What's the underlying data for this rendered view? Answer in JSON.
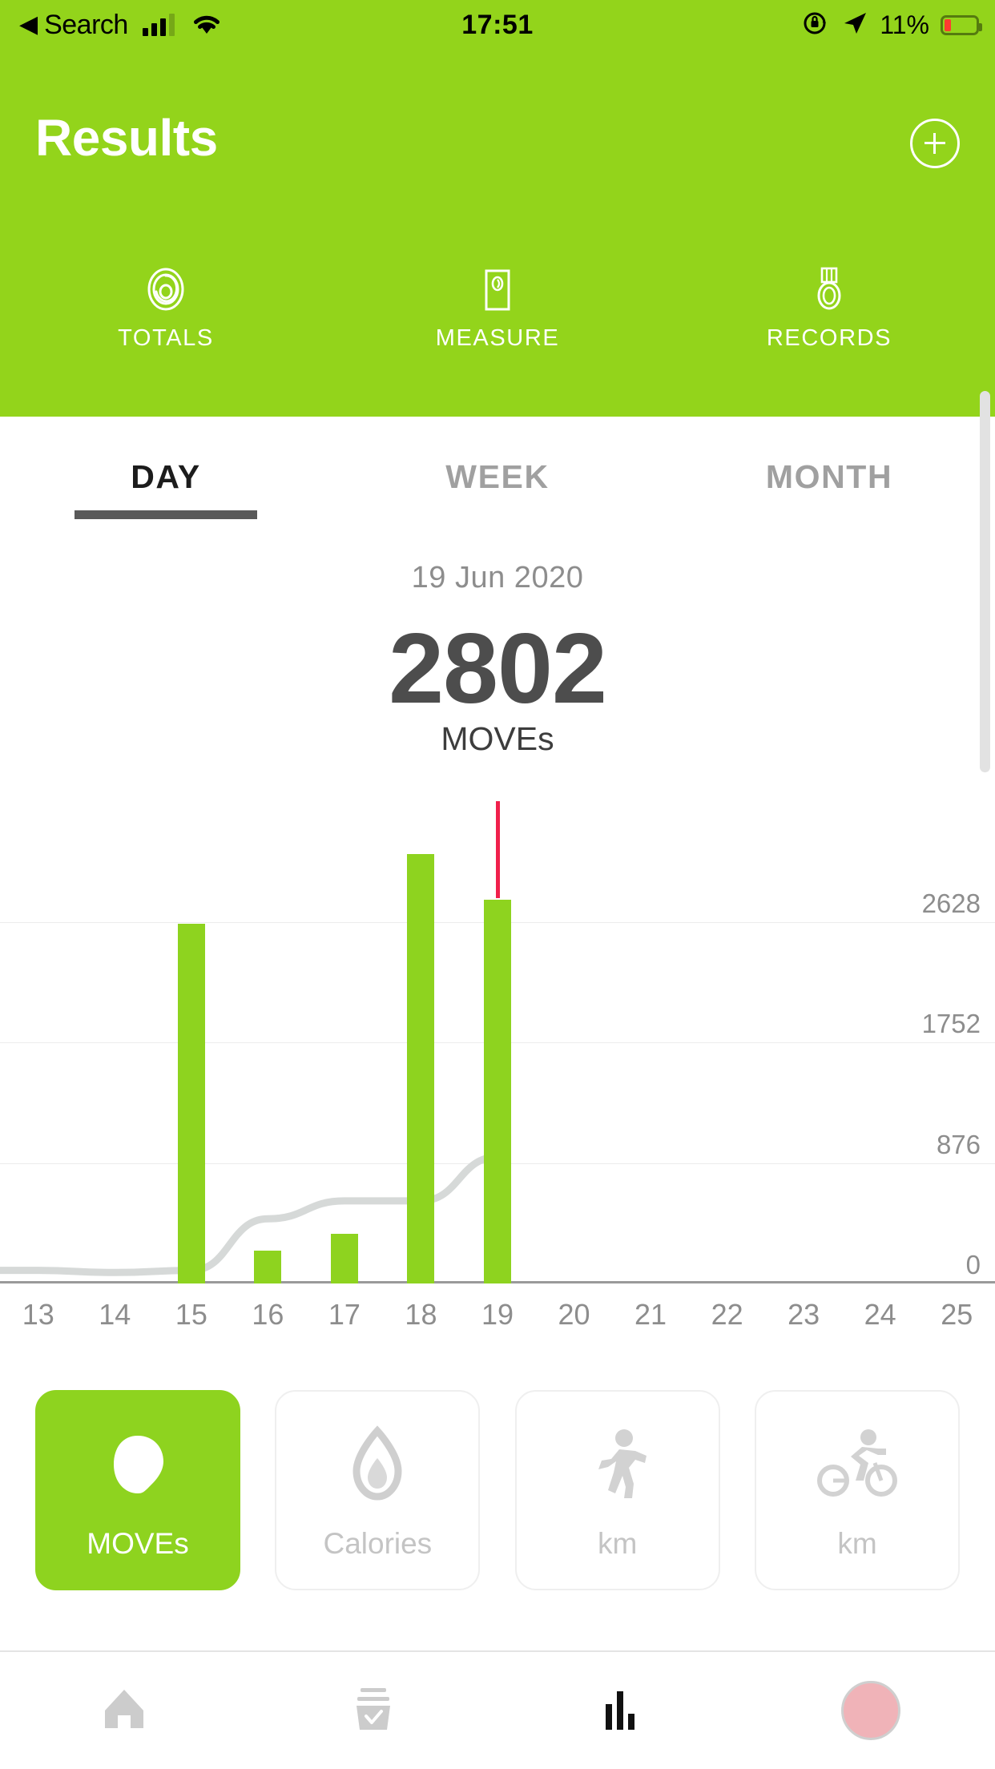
{
  "status_bar": {
    "back_label": "Search",
    "back_arrow": "back-arrow-icon",
    "signal_icon": "cellular-signal-icon",
    "wifi_icon": "wifi-icon",
    "time": "17:51",
    "rotation_lock_icon": "rotation-lock-icon",
    "location_icon": "location-arrow-icon",
    "battery_percent": "11%",
    "battery_icon": "battery-low-icon"
  },
  "header": {
    "title": "Results",
    "add_button_icon": "plus-icon",
    "background_color": "#93d41b",
    "nav": [
      {
        "label": "TOTALS",
        "icon": "rings-spiral-icon"
      },
      {
        "label": "MEASURE",
        "icon": "scale-icon"
      },
      {
        "label": "RECORDS",
        "icon": "medal-icon"
      }
    ]
  },
  "period_tabs": [
    {
      "label": "DAY",
      "active": true
    },
    {
      "label": "WEEK",
      "active": false
    },
    {
      "label": "MONTH",
      "active": false
    }
  ],
  "summary": {
    "date": "19 Jun 2020",
    "value": "2802",
    "unit": "MOVEs"
  },
  "chart_data": {
    "type": "bar",
    "title": "",
    "xlabel": "",
    "ylabel": "MOVEs",
    "categories": [
      "13",
      "14",
      "15",
      "16",
      "17",
      "18",
      "19",
      "20",
      "21",
      "22",
      "23",
      "24",
      "25"
    ],
    "values": [
      0,
      0,
      2628,
      250,
      370,
      3130,
      2802,
      0,
      0,
      0,
      0,
      0,
      0
    ],
    "ytick_labels": [
      "2628",
      "1752",
      "876",
      "0"
    ],
    "ytick_values": [
      2628,
      1752,
      876,
      0
    ],
    "ylim": [
      0,
      3504
    ],
    "grid": true,
    "legend": "none",
    "bar_color": "#8ed31f",
    "marker": {
      "category": "19",
      "value": 2802,
      "color": "#f0204b",
      "label": "selected-day-marker"
    },
    "series": [
      {
        "name": "MOVEs",
        "type": "bar",
        "values": [
          0,
          0,
          2628,
          250,
          370,
          3130,
          2802,
          0,
          0,
          0,
          0,
          0,
          0
        ]
      },
      {
        "name": "trend",
        "type": "line",
        "color": "#d6d9d8",
        "values": [
          95,
          80,
          95,
          470,
          600,
          600,
          920,
          null,
          null,
          null,
          null,
          null,
          null
        ]
      }
    ]
  },
  "metric_cards": [
    {
      "label": "MOVEs",
      "icon": "move-blob-icon",
      "active": true
    },
    {
      "label": "Calories",
      "icon": "flame-icon",
      "active": false
    },
    {
      "label": "km",
      "icon": "running-icon",
      "active": false
    },
    {
      "label": "km",
      "icon": "cycling-icon",
      "active": false
    }
  ],
  "bottom_tabs": [
    {
      "name": "home",
      "icon": "home-icon",
      "active": false
    },
    {
      "name": "tasks",
      "icon": "checklist-icon",
      "active": false
    },
    {
      "name": "results",
      "icon": "bar-chart-icon",
      "active": true
    },
    {
      "name": "profile",
      "icon": "avatar-icon",
      "active": false
    }
  ]
}
